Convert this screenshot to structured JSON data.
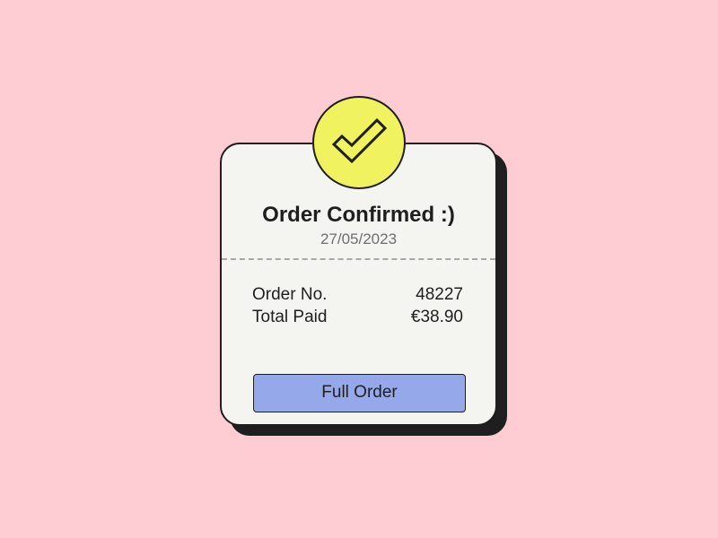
{
  "card": {
    "title": "Order Confirmed :)",
    "date": "27/05/2023",
    "details": [
      {
        "label": "Order No.",
        "value": "48227"
      },
      {
        "label": "Total Paid",
        "value": "€38.90"
      }
    ],
    "button_label": "Full Order",
    "badge_icon": "checkmark-icon"
  },
  "colors": {
    "background": "#fdcdd3",
    "card": "#f4f4f0",
    "badge": "#f0f260",
    "button": "#95a8ea",
    "outline": "#1f1f1f"
  }
}
